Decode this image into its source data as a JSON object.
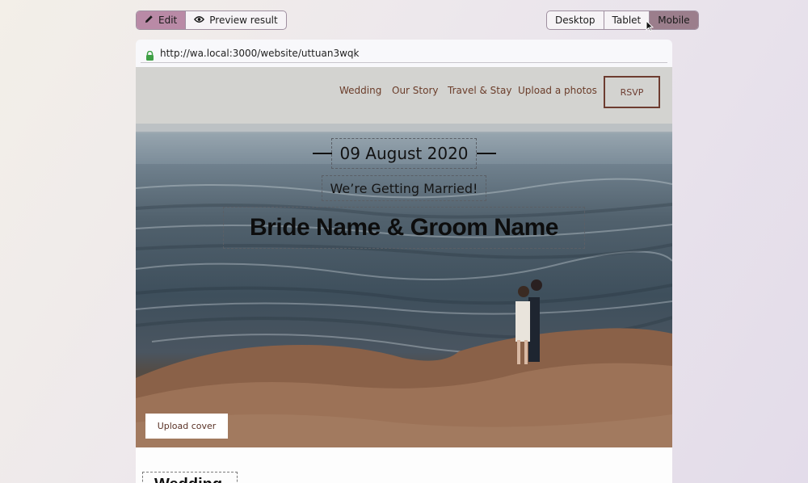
{
  "toolbar": {
    "edit_label": "Edit",
    "preview_label": "Preview result",
    "devices": [
      "Desktop",
      "Tablet",
      "Mobile"
    ],
    "active_device": "Mobile"
  },
  "address": {
    "url": "http://wa.local:3000/website/uttuan3wqk"
  },
  "nav": {
    "links": [
      "Wedding",
      "Our Story",
      "Travel & Stay",
      "Upload a photos"
    ],
    "rsvp_label": "RSVP"
  },
  "hero": {
    "date": "09 August 2020",
    "tagline": "We’re Getting Married!",
    "names": "Bride Name & Groom Name",
    "upload_cover_label": "Upload cover"
  },
  "section": {
    "heading": "Wedding"
  },
  "colors": {
    "accent_edit": "#b98aa6",
    "active_device": "#9b7e8c",
    "nav_text": "#6b3d2a",
    "lock": "#3fa046"
  },
  "icons": [
    "pencil-icon",
    "eye-icon",
    "lock-icon",
    "cursor-icon"
  ]
}
